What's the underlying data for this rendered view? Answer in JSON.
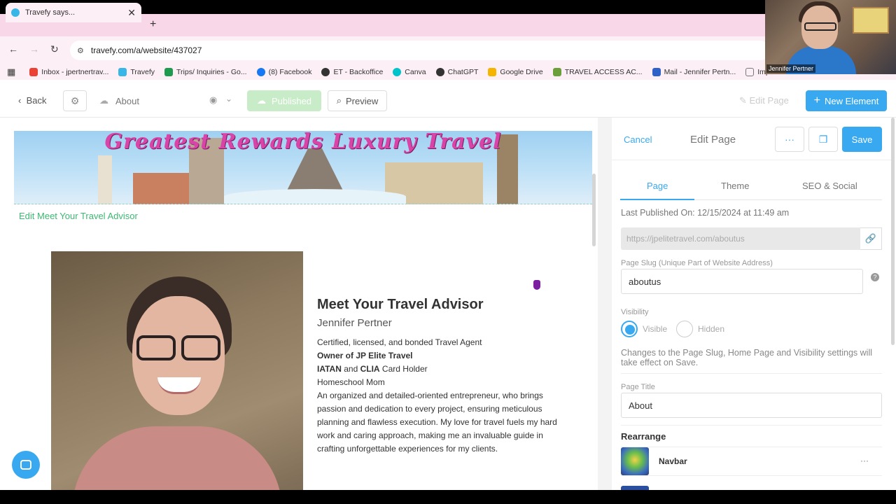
{
  "browser": {
    "tab_title": "Travefy says...",
    "tab_close": "✕",
    "new_tab": "+",
    "url": "travefy.com/a/website/437027",
    "bookmarks": [
      {
        "label": "Inbox - jpertnertrav...",
        "color": "#ea4335"
      },
      {
        "label": "Travefy",
        "color": "#38b6e8"
      },
      {
        "label": "Trips/ Inquiries - Go...",
        "color": "#1e9b4f"
      },
      {
        "label": "(8) Facebook",
        "color": "#1877f2"
      },
      {
        "label": "ET - Backoffice",
        "color": "#333333"
      },
      {
        "label": "Canva",
        "color": "#00c4cc"
      },
      {
        "label": "ChatGPT",
        "color": "#333333"
      },
      {
        "label": "Google Drive",
        "color": "#f4b400"
      },
      {
        "label": "TRAVEL ACCESS AC...",
        "color": "#6a9f3a"
      },
      {
        "label": "Mail - Jennifer Pertn...",
        "color": "#2f62c9"
      },
      {
        "label": "Imported",
        "color": "#777777"
      }
    ]
  },
  "webcam": {
    "label": "Jennifer Pertner"
  },
  "header": {
    "back_label": "Back",
    "page_name": "About",
    "published_label": "Published",
    "preview_label": "Preview",
    "edit_page_label": "Edit Page",
    "new_element_label": "New Element"
  },
  "canvas": {
    "banner_title": "Greatest Rewards Luxury Travel",
    "edit_section_label": "Edit Meet Your Travel Advisor",
    "advisor_heading": "Meet Your Travel Advisor",
    "advisor_name": "Jennifer Pertner",
    "line1": "Certified, licensed, and bonded Travel Agent",
    "line2": "Owner of JP Elite Travel",
    "line3_a": "IATAN",
    "line3_and": " and ",
    "line3_b": "CLIA",
    "line3_rest": " Card Holder",
    "line4": "Homeschool Mom",
    "bio": "An organized and detailed-oriented entrepreneur, who brings passion and dedication to every project, ensuring meticulous planning and flawless execution. My love for travel fuels my hard work and caring approach, making me an invaluable guide in crafting unforgettable experiences for my clients."
  },
  "panel": {
    "cancel_label": "Cancel",
    "title": "Edit Page",
    "more_label": "···",
    "save_label": "Save",
    "tabs": [
      "Page",
      "Theme",
      "SEO & Social"
    ],
    "last_published": "Last Published On: 12/15/2024 at 11:49 am",
    "page_url": "https://jpelitetravel.com/aboutus",
    "slug_label": "Page Slug (Unique Part of Website Address)",
    "slug_value": "aboutus",
    "help_glyph": "?",
    "visibility_label": "Visibility",
    "visible_label": "Visible",
    "hidden_label": "Hidden",
    "visibility_selected": "Visible",
    "note": "Changes to the Page Slug, Home Page and Visibility settings will take effect on Save.",
    "page_title_label": "Page Title",
    "page_title_value": "About",
    "rearrange_label": "Rearrange",
    "rearrange_items": [
      {
        "name": "Navbar",
        "more": "···"
      }
    ]
  },
  "colors": {
    "accent": "#38a9f0",
    "published": "#c8ecc8",
    "edit_link": "#3db872",
    "tab_strip": "#f7d7e8"
  }
}
